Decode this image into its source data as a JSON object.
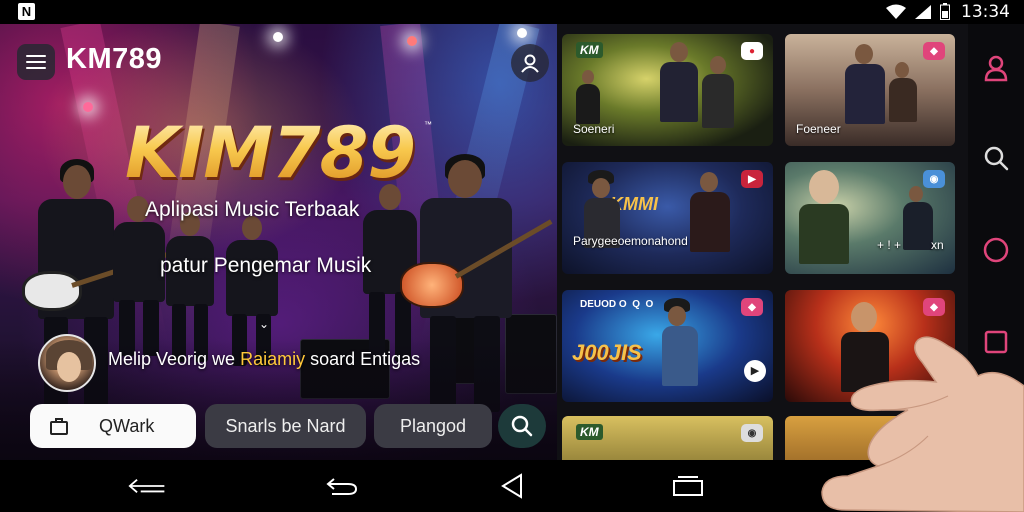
{
  "status_bar": {
    "app_badge": "N",
    "time": "13:34",
    "icons": [
      "wifi-icon",
      "signal-icon",
      "battery-icon"
    ]
  },
  "header": {
    "brand": "KM789",
    "menu_icon": "hamburger-icon",
    "profile_icon": "user-icon"
  },
  "hero": {
    "logo": "KIM789",
    "logo_mark": "™",
    "tagline_1": "Aplipasi Music Terbaak",
    "tagline_2": "patur Pengemar Musik",
    "chevron": "⌄",
    "caption_part1": "Melip Veorig we ",
    "caption_highlight": "Raiamiy",
    "caption_part2": " soard Entigas"
  },
  "actions": {
    "work_label": "QWark",
    "snarls_label": "Snarls be Nard",
    "plang_label": "Plangod",
    "search_icon": "search-icon"
  },
  "gallery": {
    "cards": [
      {
        "caption": "Soeneri",
        "top_left": "",
        "big_text": ""
      },
      {
        "caption": "Foeneer",
        "top_left": "",
        "big_text": ""
      },
      {
        "caption": "Parygeeoemonahond",
        "top_left": "",
        "big_text": "KMMI"
      },
      {
        "caption": "+ ! +         xn",
        "top_left": "",
        "big_text": ""
      },
      {
        "caption": "",
        "top_left": "DEUOD O  Q  O",
        "big_text": "J00JIS"
      },
      {
        "caption": "",
        "top_left": "",
        "big_text": ""
      },
      {
        "caption": "",
        "top_left": "",
        "big_text": ""
      },
      {
        "caption": "",
        "top_left": "",
        "big_text": ""
      }
    ]
  },
  "nav_rail": {
    "icons": [
      "user-outline-icon",
      "search-icon",
      "circle-icon",
      "square-icon"
    ]
  },
  "nav_bar": {
    "icons": [
      "back-swipe-icon",
      "undo-icon",
      "back-triangle-icon",
      "recents-icon",
      "assistant-icon"
    ]
  },
  "colors": {
    "accent_pink": "#e0457b",
    "logo_gold": "#f7c24a",
    "highlight_yellow": "#ffc83a"
  }
}
